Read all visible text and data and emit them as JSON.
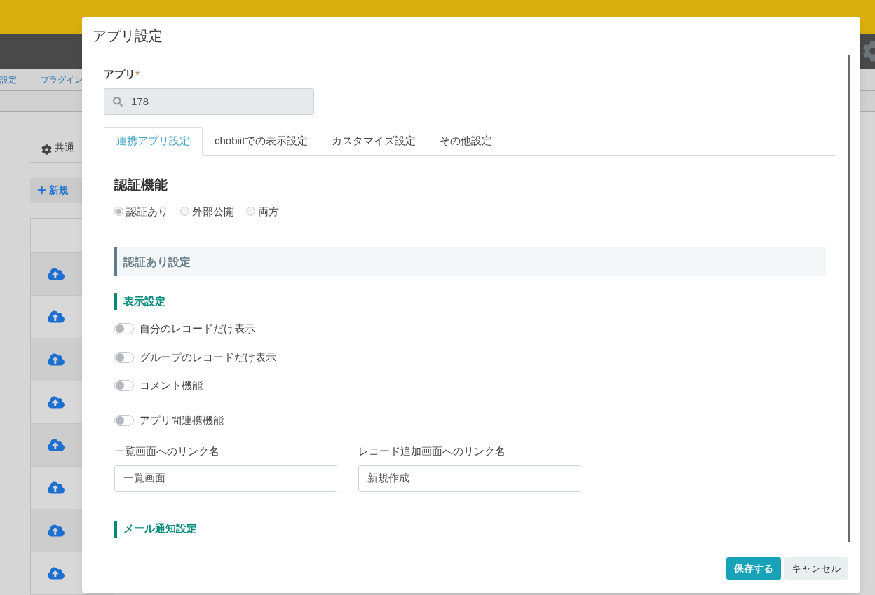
{
  "background": {
    "breadcrumbs": [
      "設定",
      "プラグイン"
    ],
    "section_tab": "共通",
    "new_button": "新規"
  },
  "dialog": {
    "title": "アプリ設定",
    "app_field": {
      "label": "アプリ",
      "required_mark": "*",
      "value": "178"
    },
    "tabs": [
      {
        "label": "連携アプリ設定",
        "selected": true
      },
      {
        "label": "chobiitでの表示設定",
        "selected": false
      },
      {
        "label": "カスタマイズ設定",
        "selected": false
      },
      {
        "label": "その他設定",
        "selected": false
      }
    ],
    "auth": {
      "heading": "認証機能",
      "options": [
        {
          "label": "認証あり",
          "selected": true
        },
        {
          "label": "外部公開",
          "selected": false
        },
        {
          "label": "両方",
          "selected": false
        }
      ]
    },
    "section_title": "認証あり設定",
    "display_settings": {
      "heading": "表示設定",
      "toggles": [
        {
          "label": "自分のレコードだけ表示",
          "on": false
        },
        {
          "label": "グループのレコードだけ表示",
          "on": false
        },
        {
          "label": "コメント機能",
          "on": false
        },
        {
          "label": "アプリ間連携機能",
          "on": false
        }
      ]
    },
    "link_fields": [
      {
        "label": "一覧画面へのリンク名",
        "value": "一覧画面"
      },
      {
        "label": "レコード追加画面へのリンク名",
        "value": "新規作成"
      }
    ],
    "mail_heading": "メール通知設定",
    "buttons": [
      {
        "label": "保存する",
        "kind": "primary"
      },
      {
        "label": "キャンセル",
        "kind": "secondary"
      }
    ]
  }
}
